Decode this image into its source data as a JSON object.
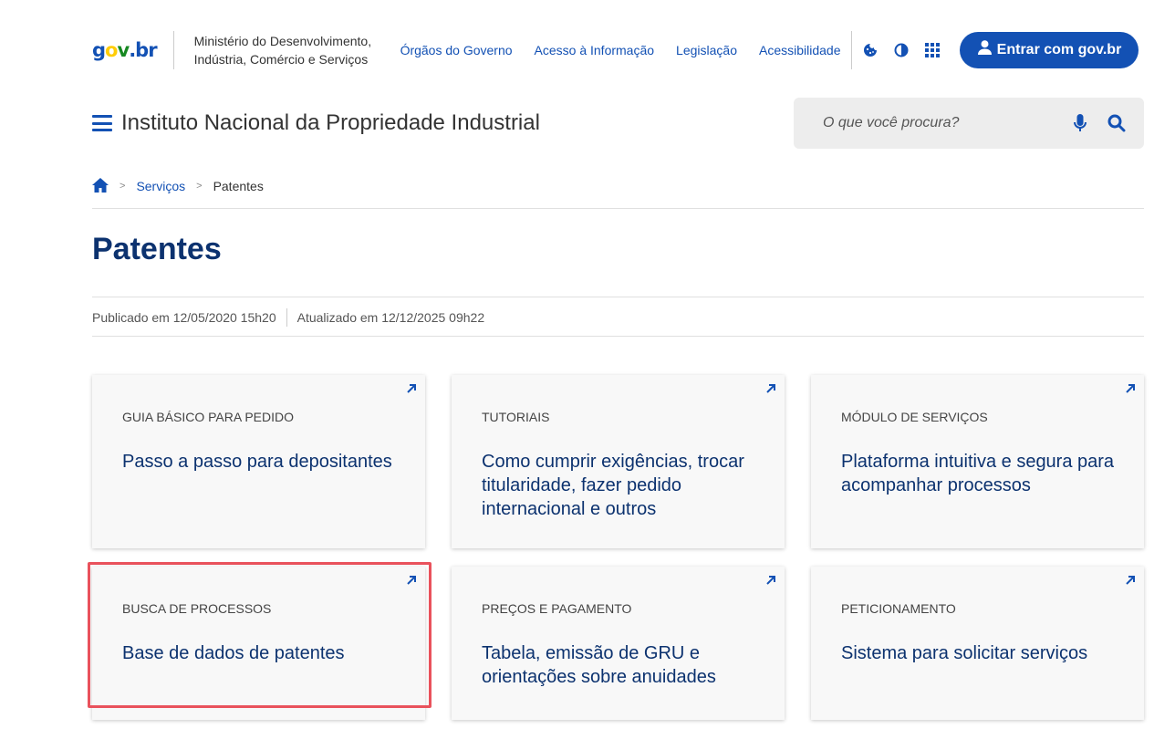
{
  "header": {
    "logo": {
      "g": "g",
      "o": "o",
      "v": "v",
      "dot": ".",
      "br": "br"
    },
    "ministry_line1": "Ministério do Desenvolvimento,",
    "ministry_line2": "Indústria, Comércio e Serviços",
    "nav": [
      "Órgãos do Governo",
      "Acesso à Informação",
      "Legislação",
      "Acessibilidade"
    ],
    "icons": [
      "cookie-icon",
      "contrast-icon",
      "apps-grid-icon"
    ],
    "login_label": "Entrar com gov.br"
  },
  "site": {
    "title": "Instituto Nacional da Propriedade Industrial",
    "search_placeholder": "O que você procura?"
  },
  "breadcrumb": {
    "sep": ">",
    "items": [
      "Serviços",
      "Patentes"
    ]
  },
  "page": {
    "title": "Patentes",
    "published": "Publicado em 12/05/2020 15h20",
    "updated": "Atualizado em 12/12/2025 09h22"
  },
  "cards": [
    {
      "category": "GUIA BÁSICO PARA PEDIDO",
      "description": "Passo a passo para depositantes"
    },
    {
      "category": "TUTORIAIS",
      "description": "Como cumprir exigências, trocar titularidade, fazer pedido internacional e outros"
    },
    {
      "category": "MÓDULO DE SERVIÇOS",
      "description": "Plataforma intuitiva e segura para acompanhar processos"
    },
    {
      "category": "BUSCA DE PROCESSOS",
      "description": "Base de dados de patentes"
    },
    {
      "category": "PREÇOS E PAGAMENTO",
      "description": "Tabela, emissão de GRU e orientações sobre anuidades"
    },
    {
      "category": "PETICIONAMENTO",
      "description": "Sistema para solicitar serviços"
    }
  ],
  "colors": {
    "primary": "#1351b4",
    "title": "#0c326f",
    "highlight": "#e9525c"
  }
}
